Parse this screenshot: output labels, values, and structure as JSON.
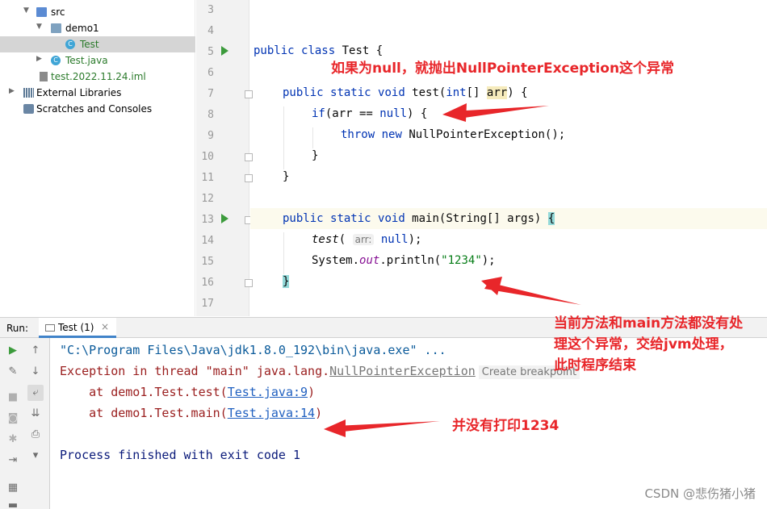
{
  "tree": {
    "items": [
      {
        "label": "src"
      },
      {
        "label": "demo1"
      },
      {
        "label": "Test"
      },
      {
        "label": "Test.java"
      },
      {
        "label": "test.2022.11.24.iml"
      },
      {
        "label": "External Libraries"
      },
      {
        "label": "Scratches and Consoles"
      }
    ]
  },
  "editor": {
    "line_numbers": [
      "3",
      "4",
      "5",
      "6",
      "7",
      "8",
      "9",
      "10",
      "11",
      "12",
      "13",
      "14",
      "15",
      "16",
      "17"
    ],
    "code": {
      "l5_kw1": "public",
      "l5_kw2": "class",
      "l5_rest": " Test {",
      "l7_kw1": "public",
      "l7_kw2": "static",
      "l7_kw3": "void",
      "l7_method": " test(",
      "l7_type": "int",
      "l7_param_pre": "[] ",
      "l7_param": "arr",
      "l7_end": ") {",
      "l8_kw": "if",
      "l8_mid": "(arr == ",
      "l8_null": "null",
      "l8_end": ") {",
      "l9_kw1": "throw",
      "l9_kw2": "new",
      "l9_rest": " NullPointerException();",
      "l10": "}",
      "l11": "}",
      "l13_kw1": "public",
      "l13_kw2": "static",
      "l13_kw3": "void",
      "l13_method": " main(String[] args) ",
      "l13_brace": "{",
      "l14_call": "test",
      "l14_open": "(",
      "l14_hint": "arr:",
      "l14_null": "null",
      "l14_end": ");",
      "l15_pre": "System.",
      "l15_out": "out",
      "l15_mid": ".println(",
      "l15_str": "\"1234\"",
      "l15_end": ");",
      "l16": "}"
    }
  },
  "run": {
    "label": "Run:",
    "tab": "Test (1)",
    "tab_close": "×"
  },
  "console": {
    "line1": "\"C:\\Program Files\\Java\\jdk1.8.0_192\\bin\\java.exe\" ...",
    "line2_pre": "Exception in thread \"main\" java.lang.",
    "line2_link": "NullPointerException",
    "line2_tip": "Create breakpoint",
    "line3_pre": "    at demo1.Test.test(",
    "line3_link": "Test.java:9",
    "line3_end": ")",
    "line4_pre": "    at demo1.Test.main(",
    "line4_link": "Test.java:14",
    "line4_end": ")",
    "line5": "Process finished with exit code 1"
  },
  "annotations": {
    "a1": "如果为null，就抛出NullPointerException这个异常",
    "a2_l1": "当前方法和main方法都没有处",
    "a2_l2": "理这个异常，交给jvm处理，",
    "a2_l3": "此时程序结束",
    "a3": "并没有打印1234"
  },
  "watermark": "CSDN @悲伤猪小猪",
  "colors": {
    "annotation": "#e8262a",
    "keyword": "#0033b3",
    "string": "#067d17",
    "error": "#9a1e1e",
    "link": "#2060c0"
  }
}
